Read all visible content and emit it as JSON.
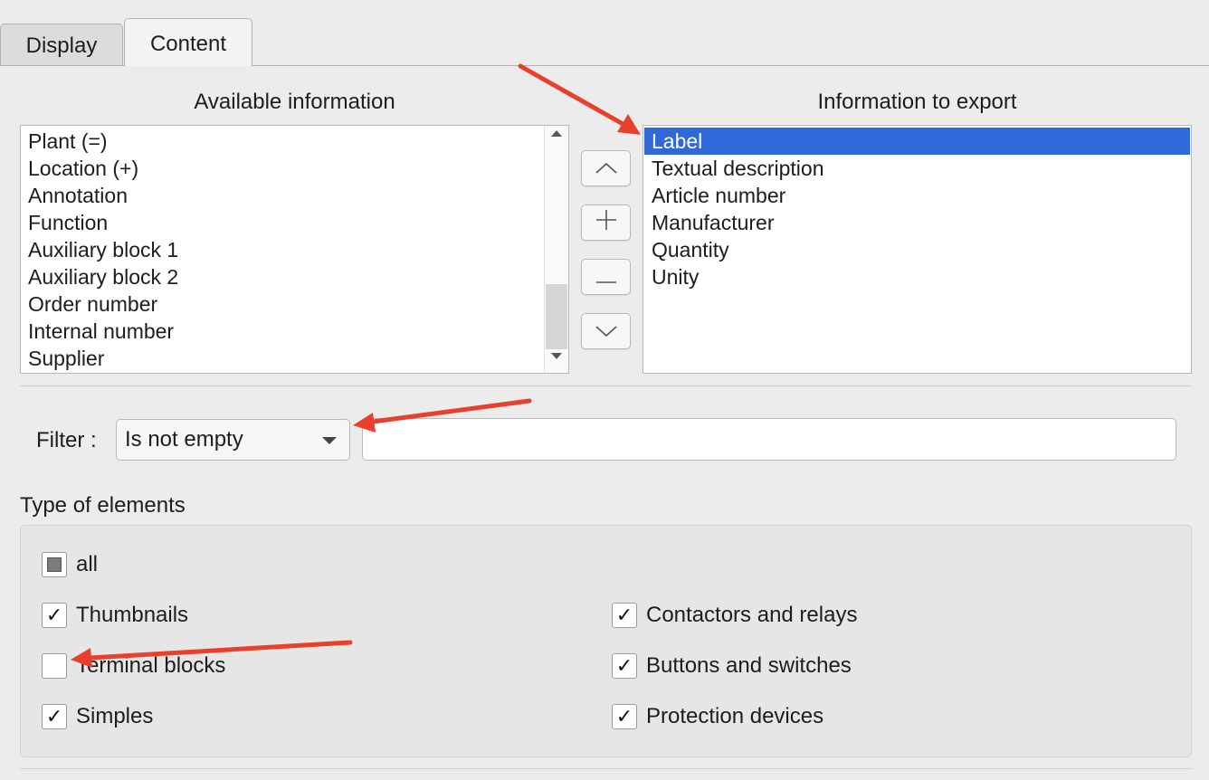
{
  "tabs": [
    {
      "label": "Display",
      "active": false
    },
    {
      "label": "Content",
      "active": true
    }
  ],
  "available": {
    "heading": "Available information",
    "items": [
      "Plant (=)",
      "Location (+)",
      "Annotation",
      "Function",
      "Auxiliary block 1",
      "Auxiliary block 2",
      "Order number",
      "Internal number",
      "Supplier"
    ]
  },
  "export": {
    "heading": "Information to export",
    "items": [
      "Label",
      "Textual description",
      "Article number",
      "Manufacturer",
      "Quantity",
      "Unity"
    ],
    "selected_index": 0
  },
  "move_buttons": {
    "up_icon": "chevron-up-icon",
    "add_icon": "plus-icon",
    "remove_icon": "minus-icon",
    "down_icon": "chevron-down-icon"
  },
  "filter": {
    "label": "Filter :",
    "selected_option": "Is not empty",
    "value": ""
  },
  "elements": {
    "title": "Type of elements",
    "all": {
      "label": "all",
      "state": "partial"
    },
    "left": [
      {
        "label": "Thumbnails",
        "checked": true
      },
      {
        "label": "Terminal blocks",
        "checked": false
      },
      {
        "label": "Simples",
        "checked": true
      }
    ],
    "right": [
      {
        "label": "Contactors and relays",
        "checked": true
      },
      {
        "label": "Buttons and switches",
        "checked": true
      },
      {
        "label": "Protection devices",
        "checked": true
      }
    ]
  },
  "colors": {
    "selection": "#2e68d9",
    "annotation_arrow": "#e8402c"
  }
}
